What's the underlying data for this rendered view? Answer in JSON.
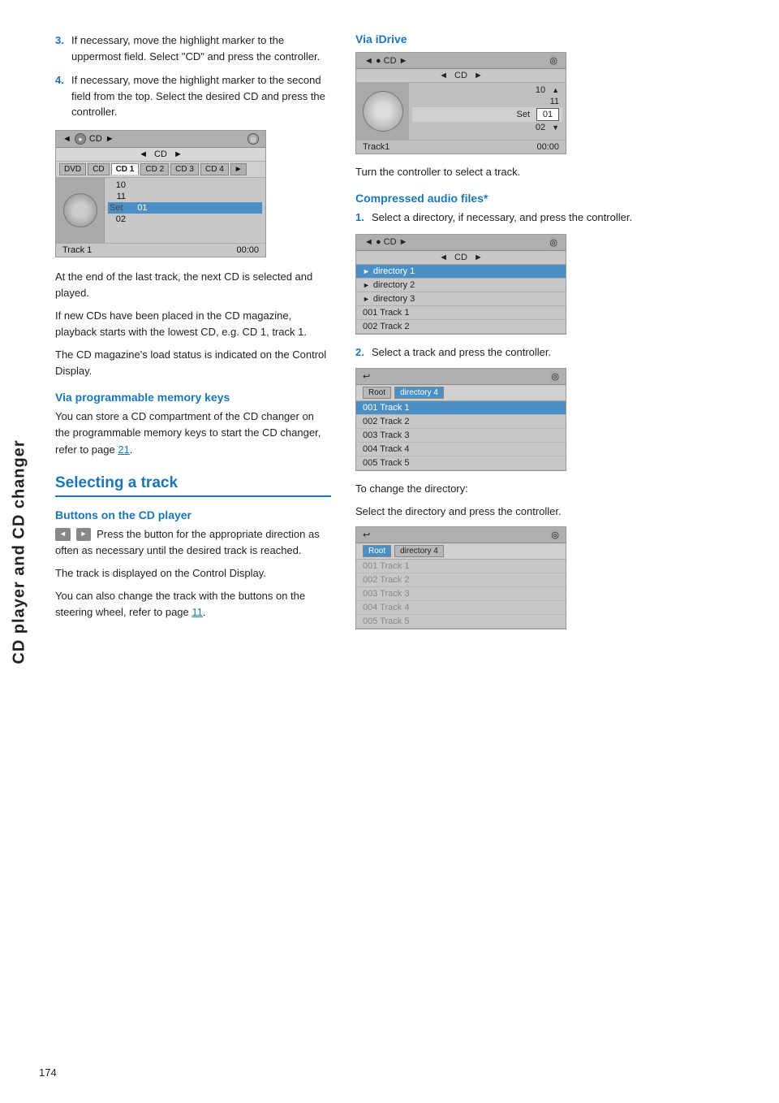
{
  "sidebar": {
    "label": "CD player and CD changer"
  },
  "page_number": "174",
  "left_col": {
    "step3": {
      "num": "3.",
      "text": "If necessary, move the highlight marker to the uppermost field. Select \"CD\" and press the controller."
    },
    "step4": {
      "num": "4.",
      "text": "If necessary, move the highlight marker to the second field from the top. Select the desired CD and press the controller."
    },
    "screen1": {
      "top_left": "◄",
      "cd_icon": "●",
      "cd_text": "CD",
      "top_right": "►",
      "corner_icon": "◎",
      "cd_bar_left": "◄",
      "cd_bar_text": "CD",
      "cd_bar_right": "►",
      "tabs": [
        "DVD",
        "CD",
        "CD 1",
        "CD 2",
        "CD 3",
        "CD 4"
      ],
      "active_tab": "CD 1",
      "arrow_tab": "►",
      "tracks": [
        {
          "num": "10",
          "highlighted": false
        },
        {
          "num": "11",
          "highlighted": false
        },
        {
          "label": "Set",
          "num": "01",
          "highlighted": true
        },
        {
          "num": "02",
          "highlighted": false
        }
      ],
      "bottom_left": "Track 1",
      "bottom_right": "00:00"
    },
    "para1": "At the end of the last track, the next CD is selected and played.",
    "para2": "If new CDs have been placed in the CD magazine, playback starts with the lowest CD, e.g. CD 1, track 1.",
    "para3": "The CD magazine's load status is indicated on the Control Display.",
    "via_programmable": {
      "heading": "Via programmable memory keys",
      "text": "You can store a CD compartment of the CD changer on the programmable memory keys to start the CD changer, refer to page 21."
    },
    "selecting_track": {
      "title": "Selecting a track",
      "buttons_heading": "Buttons on the CD player",
      "buttons_text": "Press the button for the appropriate direction as often as necessary until the desired track is reached.",
      "para1": "The track is displayed on the Control Display.",
      "para2": "You can also change the track with the buttons on the steering wheel, refer to page 11."
    }
  },
  "right_col": {
    "via_idrive": {
      "heading": "Via iDrive",
      "screen": {
        "top_left_arrow": "◄",
        "cd_icon": "●",
        "cd_text": "CD",
        "top_right_arrow": "►",
        "corner_icon": "◎",
        "cd_bar_left": "◄",
        "cd_bar_text": "CD",
        "cd_bar_right": "►",
        "tracks": [
          {
            "num": "10",
            "arrow_up": true
          },
          {
            "num": "11"
          },
          {
            "set_label": "Set",
            "num": "01"
          },
          {
            "num": "02",
            "arrow_down": true
          }
        ],
        "bottom_left": "Track1",
        "bottom_right": "00:00"
      },
      "caption": "Turn the controller to select a track."
    },
    "compressed_audio": {
      "heading": "Compressed audio files*",
      "step1": {
        "num": "1.",
        "text": "Select a directory, if necessary, and press the controller."
      },
      "dir_screen": {
        "top_left": "◄",
        "cd_icon": "●",
        "cd_text": "CD",
        "top_right": "►",
        "corner_icon": "◎",
        "cd_bar_left": "◄",
        "cd_bar_text": "CD",
        "cd_bar_right": "►",
        "items": [
          {
            "label": "directory 1",
            "highlighted": true,
            "arrow": true
          },
          {
            "label": "directory 2",
            "highlighted": false,
            "arrow": true
          },
          {
            "label": "directory 3",
            "highlighted": false,
            "arrow": true
          },
          {
            "label": "001 Track  1",
            "highlighted": false,
            "arrow": false
          },
          {
            "label": "002 Track  2",
            "highlighted": false,
            "arrow": false
          }
        ]
      },
      "step2": {
        "num": "2.",
        "text": "Select a track and press the controller."
      },
      "track_screen": {
        "back_icon": "↩",
        "corner_icon": "◎",
        "breadcrumbs": [
          "Root",
          "directory 4"
        ],
        "active_breadcrumb": "directory 4",
        "tracks": [
          {
            "label": "001 Track  1",
            "highlighted": true
          },
          {
            "label": "002 Track  2",
            "highlighted": false
          },
          {
            "label": "003 Track  3",
            "highlighted": false
          },
          {
            "label": "004 Track  4",
            "highlighted": false
          },
          {
            "label": "005 Track  5",
            "highlighted": false
          }
        ]
      },
      "change_dir_caption": "To change the directory:",
      "change_dir_text": "Select the directory and press the controller.",
      "dir_change_screen": {
        "back_icon": "↩",
        "corner_icon": "◎",
        "breadcrumbs": [
          "Root",
          "directory 4"
        ],
        "active_breadcrumb": "Root",
        "tracks": [
          {
            "label": "001 Track  1",
            "highlighted": false
          },
          {
            "label": "002 Track  2",
            "highlighted": false
          },
          {
            "label": "003 Track  3",
            "highlighted": false
          },
          {
            "label": "004 Track  4",
            "highlighted": false
          },
          {
            "label": "005 Track  5",
            "highlighted": false
          }
        ]
      }
    }
  }
}
